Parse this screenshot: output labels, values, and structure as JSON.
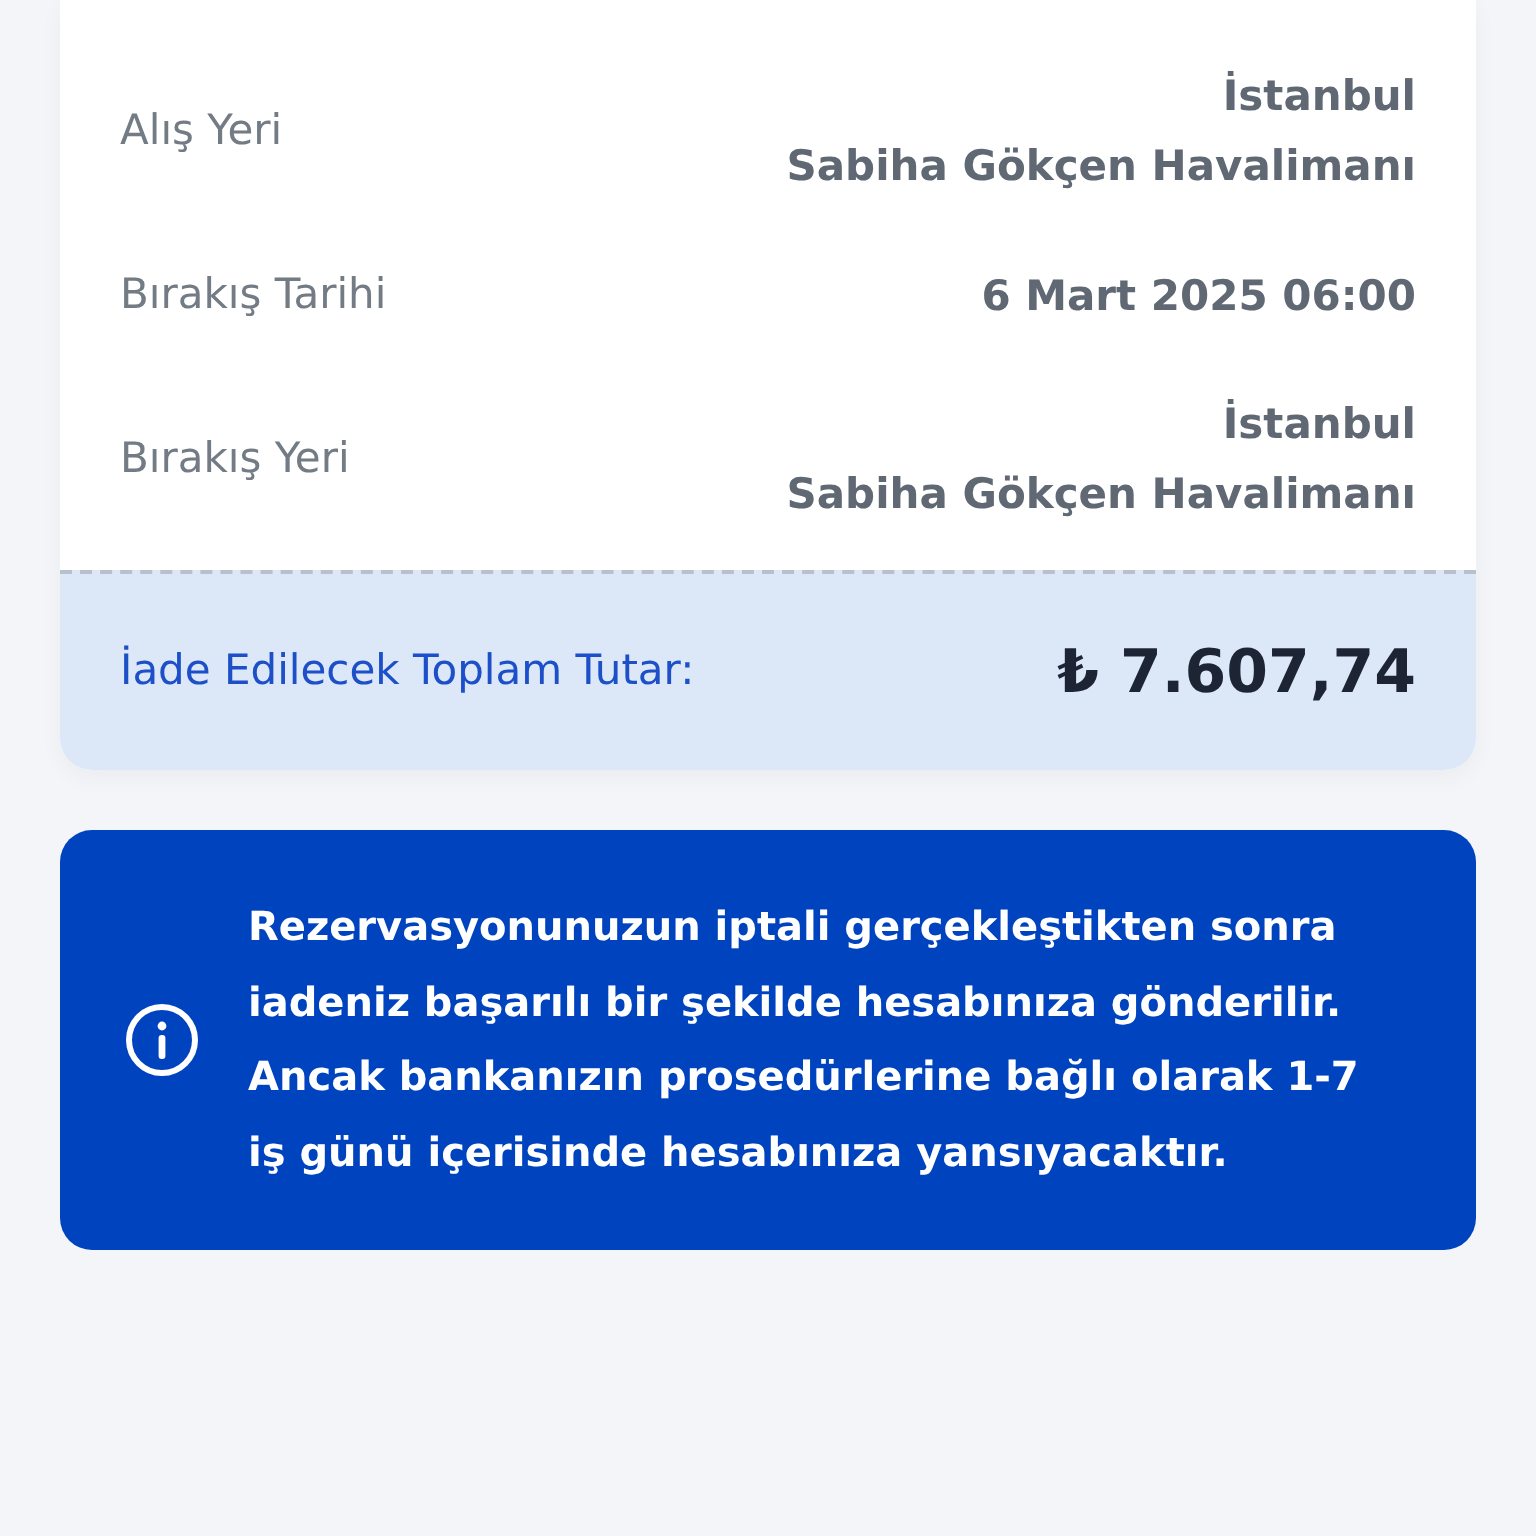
{
  "details": [
    {
      "label": "Alış Yeri",
      "value_lines": [
        "İstanbul",
        "Sabiha Gökçen Havalimanı"
      ]
    },
    {
      "label": "Bırakış Tarihi",
      "value_lines": [
        "6 Mart 2025 06:00"
      ]
    },
    {
      "label": "Bırakış Yeri",
      "value_lines": [
        "İstanbul",
        "Sabiha Gökçen Havalimanı"
      ]
    }
  ],
  "refund": {
    "label": "İade Edilecek Toplam Tutar:",
    "amount": "₺ 7.607,74"
  },
  "info": {
    "text": "Rezervasyonunuzun iptali gerçekleştikten sonra iadeniz başarılı bir şekilde hesabınıza gönderilir. Ancak bankanızın prosedürlerine bağlı olarak 1-7 iş günü içerisinde hesabınıza yansıyacaktır."
  }
}
